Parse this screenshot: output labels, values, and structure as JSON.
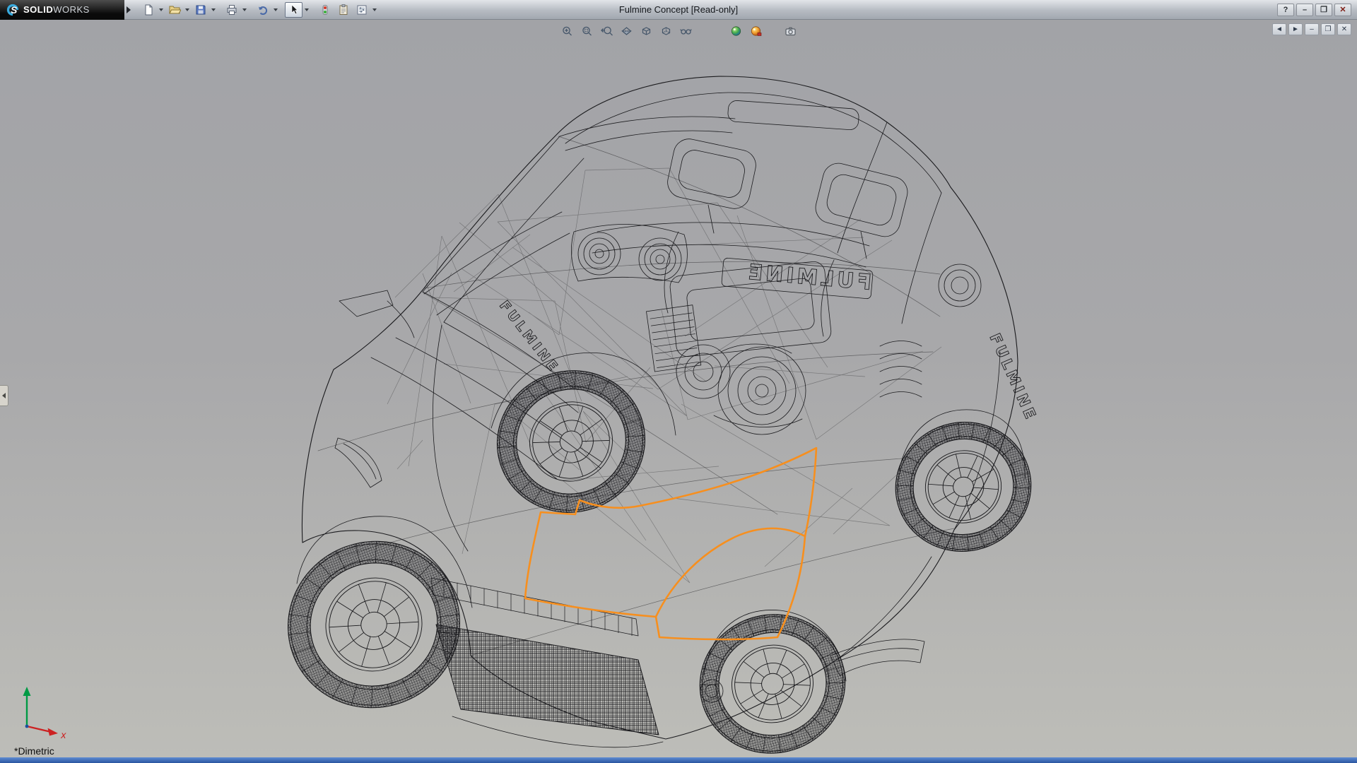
{
  "titlebar": {
    "logo": {
      "mark": "S",
      "solid": "SOLID",
      "works": "WORKS"
    },
    "title": "Fulmine Concept [Read-only]",
    "window_controls": {
      "help": "?",
      "minimize": "–",
      "maximize": "❐",
      "close": "✕"
    }
  },
  "main_toolbar": {
    "items": [
      {
        "id": "new-document",
        "icon": "new-document-icon",
        "dropdown": true
      },
      {
        "id": "open",
        "icon": "open-folder-icon",
        "dropdown": true
      },
      {
        "id": "save",
        "icon": "save-icon",
        "dropdown": true
      },
      {
        "id": "print",
        "icon": "print-icon",
        "dropdown": true
      },
      {
        "id": "undo",
        "icon": "undo-icon",
        "dropdown": true
      },
      {
        "id": "select",
        "icon": "select-cursor-icon",
        "dropdown": true,
        "active": true
      },
      {
        "id": "rebuild",
        "icon": "rebuild-traffic-light-icon",
        "dropdown": false
      },
      {
        "id": "file-properties",
        "icon": "file-properties-icon",
        "dropdown": false
      },
      {
        "id": "options",
        "icon": "options-icon",
        "dropdown": true
      }
    ]
  },
  "headsup_toolbar": {
    "items": [
      {
        "id": "zoom-to-fit",
        "icon": "zoom-fit-icon"
      },
      {
        "id": "zoom-to-area",
        "icon": "zoom-area-icon"
      },
      {
        "id": "previous-view",
        "icon": "previous-view-icon"
      },
      {
        "id": "section-view",
        "icon": "section-view-icon"
      },
      {
        "id": "view-orientation",
        "icon": "view-orientation-icon"
      },
      {
        "id": "display-style",
        "icon": "display-style-icon"
      },
      {
        "id": "hide-show-items",
        "icon": "hide-show-icon"
      },
      {
        "id": "edit-appearance",
        "icon": "appearance-ball-icon"
      },
      {
        "id": "apply-scene",
        "icon": "scene-ball-icon"
      },
      {
        "id": "view-settings",
        "icon": "view-settings-icon"
      }
    ]
  },
  "doc_window_controls": {
    "previous_window": "◄",
    "next_window": "►",
    "minimize": "–",
    "restore": "❐",
    "close": "✕"
  },
  "viewport": {
    "view_label": "*Dimetric",
    "badge_text": "FULMINE",
    "selection_color": "#F78F1E",
    "triad": {
      "x_label": "x"
    }
  }
}
